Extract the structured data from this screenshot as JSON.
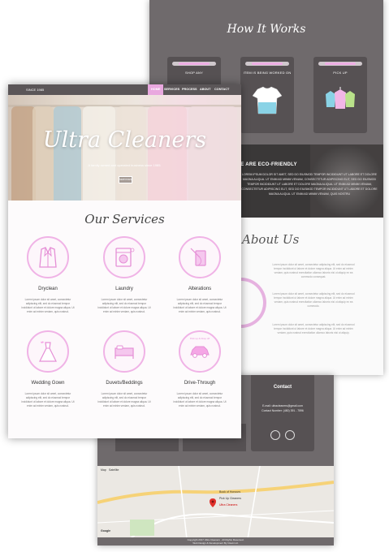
{
  "back": {
    "how_it_works": {
      "title": "How It Works",
      "steps": [
        {
          "label": "SHOP ANY"
        },
        {
          "label": "ITEM IS BEING WORKED ON"
        },
        {
          "label": "PICK UP"
        }
      ]
    },
    "eco": {
      "title": "WE ARE ECO-FRIENDLY",
      "text": "LOREM IPSUM DOLOR SIT AMET, SED DO EIUSMOD TEMPOR INCIDIDUNT UT LABORE ET DOLORE MAGNA ALIQUA. UT ENIM AD MINIM VENIAM, CONSECTETUR ADIPISCING ELIT, SED DO EIUSMOD TEMPOR INCIDIDUNT UT LABORE ET DOLORE MAGNA ALIQUA. UT ENIM AD MINIM VENIAM, CONSECTETUR ADIPISCING ELIT, SED DO EIUSMOD TEMPOR INCIDIDUNT UT LABORE ET DOLORE MAGNA ALIQUA. UT ENIM AD MINIM VENIAM, QUIS NOSTRU"
    },
    "about": {
      "title": "About Us",
      "paragraphs": [
        "Lorem ipsum dolor sit amet, consectetur adipiscing elit, sed do eiusmod tempor incididunt ut labore et dolore magna aliqua. Ut enim ad minim veniam, quis nostrud exercitation ullamco laboris nisi ut aliquip ex ea commodo consequat.",
        "Lorem ipsum dolor sit amet, consectetur adipiscing elit, sed do eiusmod tempor incididunt ut labore et dolore magna aliqua. Ut enim ad minim veniam, quis nostrud exercitation ullamco laboris nisi ut aliquip ex ea commodo.",
        "Lorem ipsum dolor sit amet, consectetur adipiscing elit, sed do eiusmod tempor incididunt ut labore et dolore magna aliqua. Ut enim ad minim veniam, quis nostrud exercitation ullamco laboris nisi ut aliquip."
      ]
    }
  },
  "bottom": {
    "contact": {
      "title": "Contact",
      "email": "E-mail: ultracleaners@gmail.com",
      "phone": "Contact Number: (480) 391 - 7596"
    },
    "map": {
      "tabs": [
        "Map",
        "Satellite"
      ],
      "brand": "Google",
      "places": [
        "Book of Honours",
        "Pick Up Cleaners",
        "Ultra Cleaners"
      ]
    },
    "footer": {
      "line1": "Copyright 2017 Ultra Cleaners . All Rights Reserved.",
      "line2": "Web Design & Development By Cisuk Ltd."
    }
  },
  "front": {
    "nav": {
      "brand": "SINCE 1985",
      "items": [
        "HOME",
        "SERVICES",
        "PROCESS",
        "ABOUT",
        "CONTACT"
      ]
    },
    "hero": {
      "title": "Ultra Cleaners",
      "subtitle": "A family owned and operated business since 1985.",
      "button": "SERVICES"
    },
    "services": {
      "title": "Our Services",
      "items": [
        {
          "name": "Dryclean",
          "icon": "suit-icon",
          "desc": "Lorem ipsum dolor sit amet, consectetur adipiscing elit, sed do eiusmod tempor incididunt ut labore et dolore magna aliqua. Ut enim ad minim veniam, quis nostrud."
        },
        {
          "name": "Laundry",
          "icon": "washing-machine-icon",
          "desc": "Lorem ipsum dolor sit amet, consectetur adipiscing elit, sed do eiusmod tempor incididunt ut labore et dolore magna aliqua. Ut enim ad minim veniam, quis nostrud."
        },
        {
          "name": "Alterations",
          "icon": "sewing-icon",
          "desc": "Lorem ipsum dolor sit amet, consectetur adipiscing elit, sed do eiusmod tempor incididunt ut labore et dolore magna aliqua. Ut enim ad minim veniam, quis nostrud."
        },
        {
          "name": "Wedding Gown",
          "icon": "wedding-gown-icon",
          "desc": "Lorem ipsum dolor sit amet, consectetur adipiscing elit, sed do eiusmod tempor incididunt ut labore et dolore magna aliqua. Ut enim ad minim veniam, quis nostrud."
        },
        {
          "name": "Duvets/Beddings",
          "icon": "bed-icon",
          "desc": "Lorem ipsum dolor sit amet, consectetur adipiscing elit, sed do eiusmod tempor incididunt ut labore et dolore magna aliqua. Ut enim ad minim veniam, quis nostrud."
        },
        {
          "name": "Drive-Through",
          "icon": "car-icon",
          "badge": "Pick up & Drop off",
          "desc": "Lorem ipsum dolor sit amet, consectetur adipiscing elit, sed do eiusmod tempor incididunt ut labore et dolore magna aliqua. Ut enim ad minim veniam, quis nostrud."
        }
      ]
    }
  },
  "colors": {
    "accent_pink": "#e9a8df",
    "dark_gray": "#6f6a6c",
    "card_gray": "#565153"
  }
}
